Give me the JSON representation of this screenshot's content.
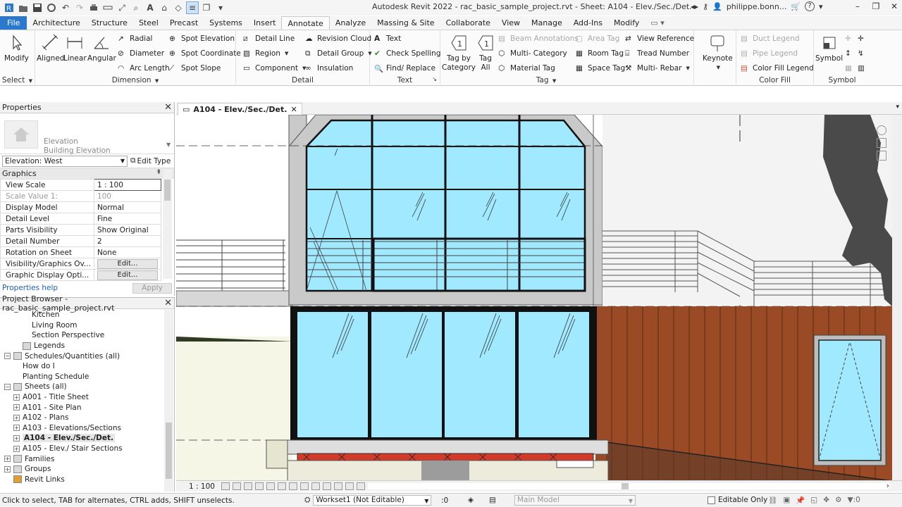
{
  "app": {
    "title": "Autodesk Revit 2022 - rac_basic_sample_project.rvt - Sheet: A104 - Elev./Sec./Det.",
    "user": "philippe.bonn...",
    "help_icon": "?"
  },
  "ribbon_tabs": [
    "File",
    "Architecture",
    "Structure",
    "Steel",
    "Precast",
    "Systems",
    "Insert",
    "Annotate",
    "Analyze",
    "Massing & Site",
    "Collaborate",
    "View",
    "Manage",
    "Add-Ins",
    "Modify"
  ],
  "ribbon": {
    "select": {
      "title": "Select",
      "modify": "Modify"
    },
    "dimension": {
      "title": "Dimension",
      "aligned": "Aligned",
      "linear": "Linear",
      "angular": "Angular",
      "radial": "Radial",
      "diameter": "Diameter",
      "arc_length": "Arc  Length",
      "spot_elevation": "Spot  Elevation",
      "spot_coordinate": "Spot  Coordinate",
      "spot_slope": "Spot  Slope"
    },
    "detail": {
      "title": "Detail",
      "detail_line": "Detail  Line",
      "region": "Region",
      "component": "Component",
      "revision_cloud": "Revision  Cloud",
      "detail_group": "Detail  Group",
      "insulation": "Insulation"
    },
    "text": {
      "title": "Text",
      "text": "Text",
      "check_spelling": "Check  Spelling",
      "find_replace": "Find/  Replace"
    },
    "tag": {
      "title": "Tag",
      "tag_by_category": "Tag by Category",
      "tag_all": "Tag All",
      "beam_annotations": "Beam  Annotations",
      "multi_category": "Multi-  Category",
      "material_tag": "Material  Tag",
      "area_tag": "Area  Tag",
      "room_tag": "Room  Tag",
      "space_tag": "Space  Tag",
      "view_reference": "View  Reference",
      "tread_number": "Tread  Number",
      "multi_rebar": "Multi-  Rebar",
      "keynote": "Keynote"
    },
    "color_fill": {
      "title": "Color Fill",
      "duct_legend": "Duct  Legend",
      "pipe_legend": "Pipe  Legend",
      "color_fill_legend": "Color Fill  Legend"
    },
    "symbol": {
      "title": "Symbol",
      "symbol": "Symbol"
    }
  },
  "properties": {
    "title": "Properties",
    "type_line1": "Elevation",
    "type_line2": "Building Elevation",
    "instance_selector": "Elevation: West",
    "edit_type": "Edit Type",
    "group": "Graphics",
    "rows": [
      {
        "label": "View Scale",
        "value": "1 : 100"
      },
      {
        "label": "Scale Value    1:",
        "value": "100"
      },
      {
        "label": "Display Model",
        "value": "Normal"
      },
      {
        "label": "Detail Level",
        "value": "Fine"
      },
      {
        "label": "Parts Visibility",
        "value": "Show Original"
      },
      {
        "label": "Detail Number",
        "value": "2"
      },
      {
        "label": "Rotation on Sheet",
        "value": "None"
      },
      {
        "label": "Visibility/Graphics Ov...",
        "value": "Edit..."
      },
      {
        "label": "Graphic Display Opti...",
        "value": "Edit..."
      }
    ],
    "help_link": "Properties help",
    "apply": "Apply"
  },
  "browser": {
    "title": "Project Browser - rac_basic_sample_project.rvt",
    "items": [
      {
        "label": "Kitchen",
        "indent": 3
      },
      {
        "label": "Living Room",
        "indent": 3
      },
      {
        "label": "Section Perspective",
        "indent": 3
      },
      {
        "label": "Legends",
        "indent": 1,
        "toggle": ""
      },
      {
        "label": "Schedules/Quantities (all)",
        "indent": 0,
        "toggle": "-"
      },
      {
        "label": "How do I",
        "indent": 2
      },
      {
        "label": "Planting Schedule",
        "indent": 2
      },
      {
        "label": "Sheets (all)",
        "indent": 0,
        "toggle": "-"
      },
      {
        "label": "A001 - Title Sheet",
        "indent": 1,
        "toggle": "+"
      },
      {
        "label": "A101 - Site Plan",
        "indent": 1,
        "toggle": "+"
      },
      {
        "label": "A102 - Plans",
        "indent": 1,
        "toggle": "+"
      },
      {
        "label": "A103 - Elevations/Sections",
        "indent": 1,
        "toggle": "+"
      },
      {
        "label": "A104 - Elev./Sec./Det.",
        "indent": 1,
        "toggle": "+"
      },
      {
        "label": "A105 - Elev./ Stair Sections",
        "indent": 1,
        "toggle": "+"
      },
      {
        "label": "Families",
        "indent": 0,
        "toggle": "+"
      },
      {
        "label": "Groups",
        "indent": 0,
        "toggle": "+"
      },
      {
        "label": "Revit Links",
        "indent": 0
      }
    ]
  },
  "view": {
    "tab_label": "A104 - Elev./Sec./Det.",
    "scale": "1 : 100"
  },
  "status": {
    "message": "Click to select, TAB for alternates, CTRL adds, SHIFT unselects.",
    "workset": "Workset1 (Not Editable)",
    "count": ":0",
    "model": "Main Model",
    "editable_only": "Editable Only",
    "filter_count": ":0"
  },
  "colors": {
    "file_tab": "#2a79cf",
    "glass": "#a0e9ff",
    "cladding": "#9b4a26",
    "roof": "#bcbcbc"
  }
}
